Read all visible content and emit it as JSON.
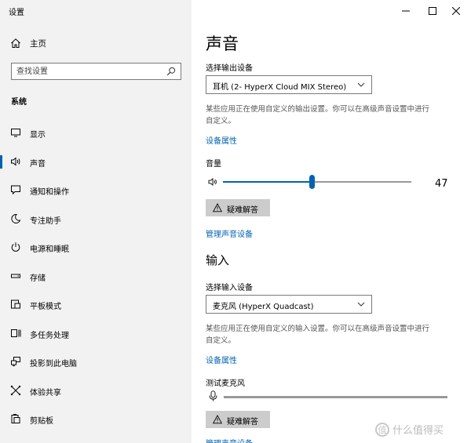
{
  "app_title": "设置",
  "sidebar": {
    "home_label": "主页",
    "search_placeholder": "查找设置",
    "section_label": "系统",
    "items": [
      {
        "label": "显示",
        "icon": "monitor-icon"
      },
      {
        "label": "声音",
        "icon": "speaker-icon",
        "selected": true
      },
      {
        "label": "通知和操作",
        "icon": "notification-icon"
      },
      {
        "label": "专注助手",
        "icon": "moon-icon"
      },
      {
        "label": "电源和睡眠",
        "icon": "power-icon"
      },
      {
        "label": "存储",
        "icon": "storage-icon"
      },
      {
        "label": "平板模式",
        "icon": "tablet-icon"
      },
      {
        "label": "多任务处理",
        "icon": "multitask-icon"
      },
      {
        "label": "投影到此电脑",
        "icon": "projection-icon"
      },
      {
        "label": "体验共享",
        "icon": "share-icon"
      },
      {
        "label": "剪贴板",
        "icon": "clipboard-icon"
      }
    ]
  },
  "main": {
    "title": "声音",
    "output": {
      "select_label": "选择输出设备",
      "device": "耳机 (2- HyperX Cloud MIX Stereo)",
      "desc_line1": "某些应用正在使用自定义的输出设置。你可以在高级声音设置中进行",
      "desc_line2": "自定义。",
      "props_link": "设备属性",
      "volume_label": "音量",
      "volume": 47,
      "troubleshoot": "疑难解答",
      "manage_link": "管理声音设备"
    },
    "input": {
      "heading": "输入",
      "select_label": "选择输入设备",
      "device": "麦克风 (HyperX Quadcast)",
      "desc_line1": "某些应用正在使用自定义的输入设置。你可以在高级声音设置中进行",
      "desc_line2": "自定义。",
      "props_link": "设备属性",
      "test_label": "测试麦克风",
      "mic_level": 0,
      "troubleshoot": "疑难解答",
      "manage_link": "管理声音设备"
    }
  },
  "watermark": "什么值得买",
  "watermark_badge": "值",
  "colors": {
    "accent": "#0063b1",
    "sidebar_bg": "#f2f2f2",
    "button_bg": "#cccccc"
  }
}
